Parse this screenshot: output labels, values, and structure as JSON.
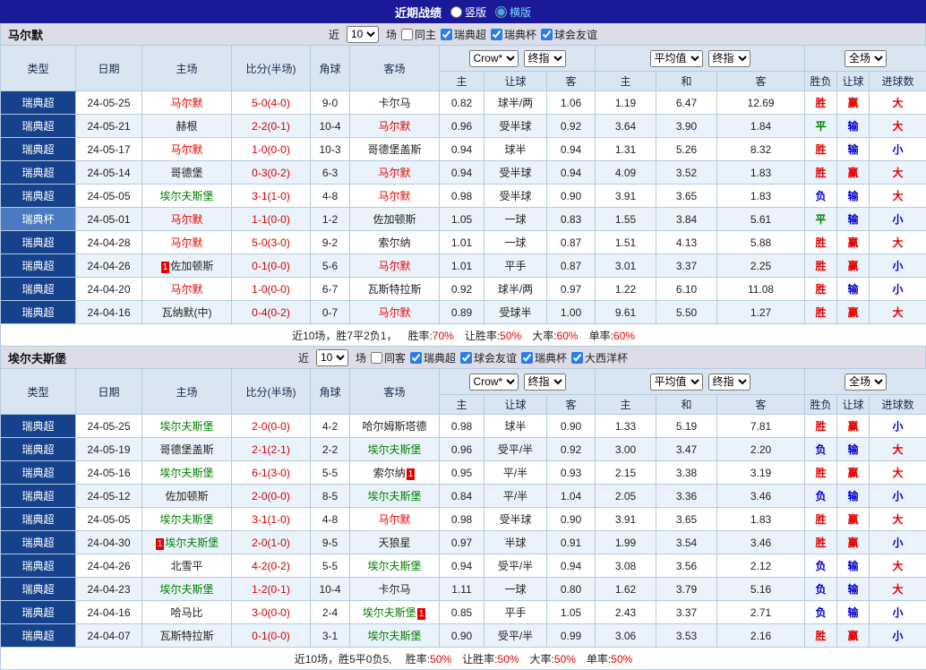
{
  "topbar": {
    "title": "近期战绩",
    "options": [
      {
        "label": "竖版",
        "selected": false
      },
      {
        "label": "横版",
        "selected": true
      }
    ]
  },
  "colors": {
    "team_red": "#e60000",
    "team_green": "#008000",
    "score": "#d40000",
    "league_badge": "#16418c",
    "cup_badge": "#4a7ac2",
    "result": {
      "胜": "#e60000",
      "平": "#008000",
      "负": "#0000cc",
      "赢": "#e60000",
      "输": "#0000cc",
      "大": "#e60000",
      "小": "#0000cc"
    }
  },
  "table_header": {
    "static_cols": [
      "类型",
      "日期",
      "主场",
      "比分(半场)",
      "角球",
      "客场"
    ],
    "asian_selects": [
      "Crow*",
      "终指"
    ],
    "euro_selects": [
      "平均值",
      "终指"
    ],
    "result_select": "全场",
    "sub_cols": [
      "主",
      "让球",
      "客",
      "主",
      "和",
      "客",
      "胜负",
      "让球",
      "进球数"
    ]
  },
  "sections": [
    {
      "team": "马尔默",
      "filter": {
        "prefix": "近",
        "count": "10",
        "suffix": "场",
        "checks": [
          {
            "label": "同主",
            "checked": false
          },
          {
            "label": "瑞典超",
            "checked": true
          },
          {
            "label": "瑞典杯",
            "checked": true
          },
          {
            "label": "球会友谊",
            "checked": true
          }
        ]
      },
      "rows": [
        {
          "type": "瑞典超",
          "cup": false,
          "date": "24-05-25",
          "home": {
            "name": "马尔默",
            "color": "red"
          },
          "score": "5-0(4-0)",
          "corners": "9-0",
          "away": {
            "name": "卡尔马"
          },
          "asian": [
            "0.82",
            "球半/两",
            "1.06"
          ],
          "euro": [
            "1.19",
            "6.47",
            "12.69"
          ],
          "results": [
            "胜",
            "赢",
            "大"
          ]
        },
        {
          "type": "瑞典超",
          "cup": false,
          "date": "24-05-21",
          "home": {
            "name": "赫根"
          },
          "score": "2-2(0-1)",
          "corners": "10-4",
          "away": {
            "name": "马尔默",
            "color": "red"
          },
          "asian": [
            "0.96",
            "受半球",
            "0.92"
          ],
          "euro": [
            "3.64",
            "3.90",
            "1.84"
          ],
          "results": [
            "平",
            "输",
            "大"
          ]
        },
        {
          "type": "瑞典超",
          "cup": false,
          "date": "24-05-17",
          "home": {
            "name": "马尔默",
            "color": "red"
          },
          "score": "1-0(0-0)",
          "corners": "10-3",
          "away": {
            "name": "哥德堡盖斯"
          },
          "asian": [
            "0.94",
            "球半",
            "0.94"
          ],
          "euro": [
            "1.31",
            "5.26",
            "8.32"
          ],
          "results": [
            "胜",
            "输",
            "小"
          ]
        },
        {
          "type": "瑞典超",
          "cup": false,
          "date": "24-05-14",
          "home": {
            "name": "哥德堡"
          },
          "score": "0-3(0-2)",
          "corners": "6-3",
          "away": {
            "name": "马尔默",
            "color": "red"
          },
          "asian": [
            "0.94",
            "受半球",
            "0.94"
          ],
          "euro": [
            "4.09",
            "3.52",
            "1.83"
          ],
          "results": [
            "胜",
            "赢",
            "大"
          ]
        },
        {
          "type": "瑞典超",
          "cup": false,
          "date": "24-05-05",
          "home": {
            "name": "埃尔夫斯堡",
            "color": "green"
          },
          "score": "3-1(1-0)",
          "corners": "4-8",
          "away": {
            "name": "马尔默",
            "color": "red"
          },
          "asian": [
            "0.98",
            "受半球",
            "0.90"
          ],
          "euro": [
            "3.91",
            "3.65",
            "1.83"
          ],
          "results": [
            "负",
            "输",
            "大"
          ]
        },
        {
          "type": "瑞典杯",
          "cup": true,
          "date": "24-05-01",
          "home": {
            "name": "马尔默",
            "color": "red"
          },
          "score": "1-1(0-0)",
          "corners": "1-2",
          "away": {
            "name": "佐加顿斯"
          },
          "asian": [
            "1.05",
            "一球",
            "0.83"
          ],
          "euro": [
            "1.55",
            "3.84",
            "5.61"
          ],
          "results": [
            "平",
            "输",
            "小"
          ]
        },
        {
          "type": "瑞典超",
          "cup": false,
          "date": "24-04-28",
          "home": {
            "name": "马尔默",
            "color": "red"
          },
          "score": "5-0(3-0)",
          "corners": "9-2",
          "away": {
            "name": "索尔纳"
          },
          "asian": [
            "1.01",
            "一球",
            "0.87"
          ],
          "euro": [
            "1.51",
            "4.13",
            "5.88"
          ],
          "results": [
            "胜",
            "赢",
            "大"
          ]
        },
        {
          "type": "瑞典超",
          "cup": false,
          "date": "24-04-26",
          "home": {
            "name": "佐加顿斯",
            "card": "1",
            "card_pos": "before"
          },
          "score": "0-1(0-0)",
          "corners": "5-6",
          "away": {
            "name": "马尔默",
            "color": "red"
          },
          "asian": [
            "1.01",
            "平手",
            "0.87"
          ],
          "euro": [
            "3.01",
            "3.37",
            "2.25"
          ],
          "results": [
            "胜",
            "赢",
            "小"
          ]
        },
        {
          "type": "瑞典超",
          "cup": false,
          "date": "24-04-20",
          "home": {
            "name": "马尔默",
            "color": "red"
          },
          "score": "1-0(0-0)",
          "corners": "6-7",
          "away": {
            "name": "瓦斯特拉斯"
          },
          "asian": [
            "0.92",
            "球半/两",
            "0.97"
          ],
          "euro": [
            "1.22",
            "6.10",
            "11.08"
          ],
          "results": [
            "胜",
            "输",
            "小"
          ]
        },
        {
          "type": "瑞典超",
          "cup": false,
          "date": "24-04-16",
          "home": {
            "name": "瓦纳默(中)"
          },
          "score": "0-4(0-2)",
          "corners": "0-7",
          "away": {
            "name": "马尔默",
            "color": "red"
          },
          "asian": [
            "0.89",
            "受球半",
            "1.00"
          ],
          "euro": [
            "9.61",
            "5.50",
            "1.27"
          ],
          "results": [
            "胜",
            "赢",
            "大"
          ]
        }
      ],
      "footer": {
        "prefix": "近10场，胜7平2负1，",
        "stats": [
          {
            "label": "胜率:",
            "value": "70%"
          },
          {
            "label": "让胜率:",
            "value": "50%"
          },
          {
            "label": "大率:",
            "value": "60%"
          },
          {
            "label": "单率:",
            "value": "60%"
          }
        ]
      }
    },
    {
      "team": "埃尔夫斯堡",
      "filter": {
        "prefix": "近",
        "count": "10",
        "suffix": "场",
        "checks": [
          {
            "label": "同客",
            "checked": false
          },
          {
            "label": "瑞典超",
            "checked": true
          },
          {
            "label": "球会友谊",
            "checked": true
          },
          {
            "label": "瑞典杯",
            "checked": true
          },
          {
            "label": "大西洋杯",
            "checked": true
          }
        ]
      },
      "rows": [
        {
          "type": "瑞典超",
          "cup": false,
          "date": "24-05-25",
          "home": {
            "name": "埃尔夫斯堡",
            "color": "green"
          },
          "score": "2-0(0-0)",
          "corners": "4-2",
          "away": {
            "name": "哈尔姆斯塔德"
          },
          "asian": [
            "0.98",
            "球半",
            "0.90"
          ],
          "euro": [
            "1.33",
            "5.19",
            "7.81"
          ],
          "results": [
            "胜",
            "赢",
            "小"
          ]
        },
        {
          "type": "瑞典超",
          "cup": false,
          "date": "24-05-19",
          "home": {
            "name": "哥德堡盖斯"
          },
          "score": "2-1(2-1)",
          "corners": "2-2",
          "away": {
            "name": "埃尔夫斯堡",
            "color": "green"
          },
          "asian": [
            "0.96",
            "受平/半",
            "0.92"
          ],
          "euro": [
            "3.00",
            "3.47",
            "2.20"
          ],
          "results": [
            "负",
            "输",
            "大"
          ]
        },
        {
          "type": "瑞典超",
          "cup": false,
          "date": "24-05-16",
          "home": {
            "name": "埃尔夫斯堡",
            "color": "green"
          },
          "score": "6-1(3-0)",
          "corners": "5-5",
          "away": {
            "name": "索尔纳",
            "card": "1",
            "card_pos": "after"
          },
          "asian": [
            "0.95",
            "平/半",
            "0.93"
          ],
          "euro": [
            "2.15",
            "3.38",
            "3.19"
          ],
          "results": [
            "胜",
            "赢",
            "大"
          ]
        },
        {
          "type": "瑞典超",
          "cup": false,
          "date": "24-05-12",
          "home": {
            "name": "佐加顿斯"
          },
          "score": "2-0(0-0)",
          "corners": "8-5",
          "away": {
            "name": "埃尔夫斯堡",
            "color": "green"
          },
          "asian": [
            "0.84",
            "平/半",
            "1.04"
          ],
          "euro": [
            "2.05",
            "3.36",
            "3.46"
          ],
          "results": [
            "负",
            "输",
            "小"
          ]
        },
        {
          "type": "瑞典超",
          "cup": false,
          "date": "24-05-05",
          "home": {
            "name": "埃尔夫斯堡",
            "color": "green"
          },
          "score": "3-1(1-0)",
          "corners": "4-8",
          "away": {
            "name": "马尔默",
            "color": "red"
          },
          "asian": [
            "0.98",
            "受半球",
            "0.90"
          ],
          "euro": [
            "3.91",
            "3.65",
            "1.83"
          ],
          "results": [
            "胜",
            "赢",
            "大"
          ]
        },
        {
          "type": "瑞典超",
          "cup": false,
          "date": "24-04-30",
          "home": {
            "name": "埃尔夫斯堡",
            "color": "green",
            "card": "1",
            "card_pos": "before"
          },
          "score": "2-0(1-0)",
          "corners": "9-5",
          "away": {
            "name": "天狼星"
          },
          "asian": [
            "0.97",
            "半球",
            "0.91"
          ],
          "euro": [
            "1.99",
            "3.54",
            "3.46"
          ],
          "results": [
            "胜",
            "赢",
            "小"
          ]
        },
        {
          "type": "瑞典超",
          "cup": false,
          "date": "24-04-26",
          "home": {
            "name": "北雪平"
          },
          "score": "4-2(0-2)",
          "corners": "5-5",
          "away": {
            "name": "埃尔夫斯堡",
            "color": "green"
          },
          "asian": [
            "0.94",
            "受平/半",
            "0.94"
          ],
          "euro": [
            "3.08",
            "3.56",
            "2.12"
          ],
          "results": [
            "负",
            "输",
            "大"
          ]
        },
        {
          "type": "瑞典超",
          "cup": false,
          "date": "24-04-23",
          "home": {
            "name": "埃尔夫斯堡",
            "color": "green"
          },
          "score": "1-2(0-1)",
          "corners": "10-4",
          "away": {
            "name": "卡尔马"
          },
          "asian": [
            "1.11",
            "一球",
            "0.80"
          ],
          "euro": [
            "1.62",
            "3.79",
            "5.16"
          ],
          "results": [
            "负",
            "输",
            "大"
          ]
        },
        {
          "type": "瑞典超",
          "cup": false,
          "date": "24-04-16",
          "home": {
            "name": "哈马比"
          },
          "score": "3-0(0-0)",
          "corners": "2-4",
          "away": {
            "name": "埃尔夫斯堡",
            "color": "green",
            "card": "1",
            "card_pos": "after"
          },
          "asian": [
            "0.85",
            "平手",
            "1.05"
          ],
          "euro": [
            "2.43",
            "3.37",
            "2.71"
          ],
          "results": [
            "负",
            "输",
            "小"
          ]
        },
        {
          "type": "瑞典超",
          "cup": false,
          "date": "24-04-07",
          "home": {
            "name": "瓦斯特拉斯"
          },
          "score": "0-1(0-0)",
          "corners": "3-1",
          "away": {
            "name": "埃尔夫斯堡",
            "color": "green"
          },
          "asian": [
            "0.90",
            "受平/半",
            "0.99"
          ],
          "euro": [
            "3.06",
            "3.53",
            "2.16"
          ],
          "results": [
            "胜",
            "赢",
            "小"
          ]
        }
      ],
      "footer": {
        "prefix": "近10场，胜5平0负5, ",
        "stats": [
          {
            "label": "胜率:",
            "value": "50%"
          },
          {
            "label": "让胜率:",
            "value": "50%"
          },
          {
            "label": "大率:",
            "value": "50%"
          },
          {
            "label": "单率:",
            "value": "50%"
          }
        ]
      }
    }
  ]
}
